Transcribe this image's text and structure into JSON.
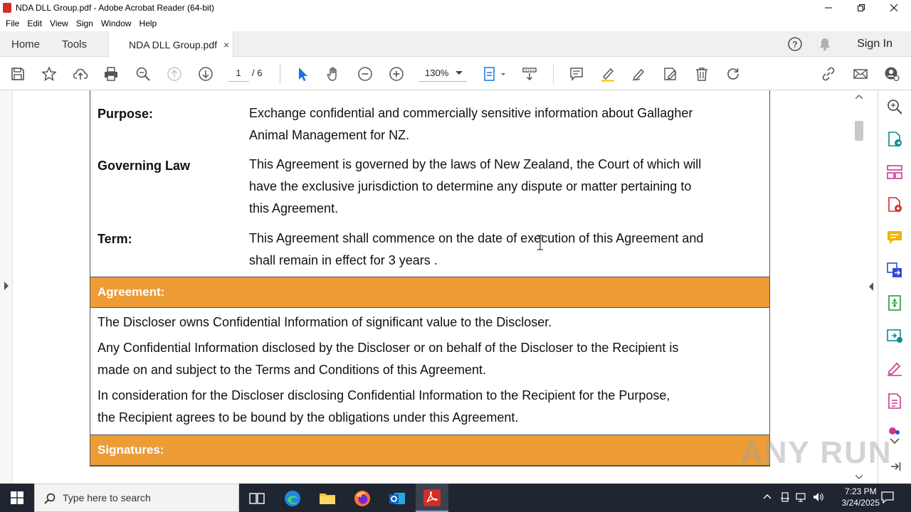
{
  "window": {
    "title": "NDA DLL Group.pdf - Adobe Acrobat Reader (64-bit)",
    "minimize_icon": "minimize-icon",
    "maximize_icon": "restore-icon",
    "close_icon": "close-icon"
  },
  "menu": {
    "items": [
      "File",
      "Edit",
      "View",
      "Sign",
      "Window",
      "Help"
    ]
  },
  "tabs": {
    "home": "Home",
    "tools": "Tools",
    "document": "NDA DLL Group.pdf",
    "close_glyph": "×",
    "sign_in": "Sign In"
  },
  "toolbar": {
    "page_current": "1",
    "page_total": "/ 6",
    "zoom": "130%"
  },
  "document": {
    "rows": [
      {
        "label": "Purpose:",
        "lines": [
          "Exchange confidential and commercially sensitive information about Gallagher",
          "Animal Management for NZ."
        ]
      },
      {
        "label": "Governing Law",
        "lines": [
          "This Agreement is governed by the laws of New Zealand, the Court of which will",
          "have the exclusive jurisdiction to determine any dispute or matter pertaining to",
          "this Agreement."
        ]
      },
      {
        "label": "Term:",
        "lines": [
          "This Agreement shall commence on the date of execution of this Agreement and",
          "shall remain in effect for 3 years ."
        ]
      }
    ],
    "agreement_header": "Agreement:",
    "agreement_lines": [
      "The Discloser owns Confidential Information of significant value to the Discloser.",
      "Any Confidential Information disclosed by the Discloser or on behalf of the Discloser to the Recipient is",
      "made on and subject to the Terms and Conditions of this Agreement.",
      "In consideration for the Discloser disclosing Confidential Information to the Recipient for the Purpose,",
      "the Recipient agrees to be bound by the obligations under this Agreement."
    ],
    "signatures_header": "Signatures:"
  },
  "watermark": "ANY RUN",
  "taskbar": {
    "search_placeholder": "Type here to search",
    "time": "7:23 PM",
    "date": "3/24/2025"
  },
  "colors": {
    "band": "#ed9c36",
    "acrobat_red": "#d32d27",
    "taskbar": "#1f2631",
    "tool_blue": "#1473e6"
  }
}
